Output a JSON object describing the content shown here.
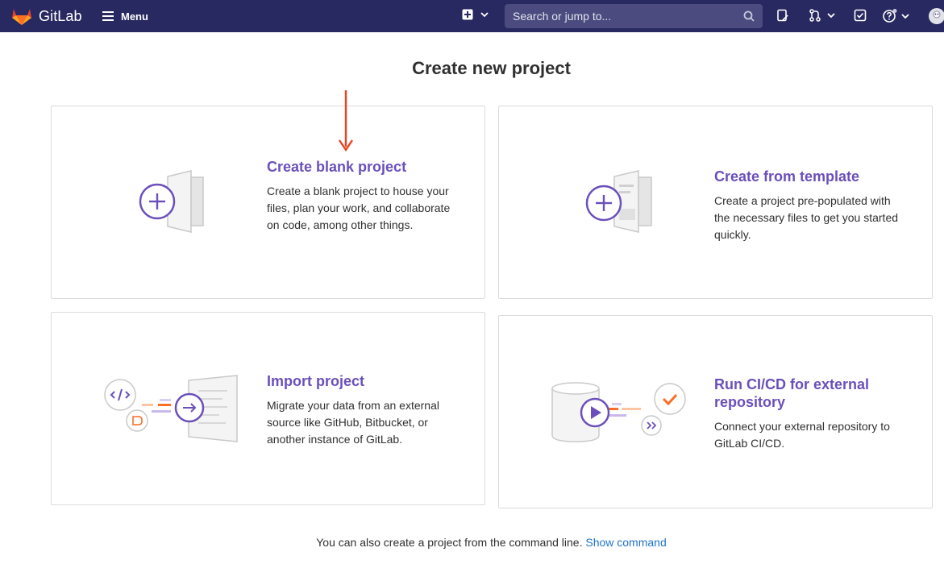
{
  "navbar": {
    "brand": "GitLab",
    "menu_label": "Menu",
    "search_placeholder": "Search or jump to..."
  },
  "page_title": "Create new project",
  "cards": {
    "blank": {
      "title": "Create blank project",
      "description": "Create a blank project to house your files, plan your work, and collaborate on code, among other things."
    },
    "template": {
      "title": "Create from template",
      "description": "Create a project pre-populated with the necessary files to get you started quickly."
    },
    "import": {
      "title": "Import project",
      "description": "Migrate your data from an external source like GitHub, Bitbucket, or another instance of GitLab."
    },
    "cicd": {
      "title": "Run CI/CD for external repository",
      "description": "Connect your external repository to GitLab CI/CD."
    }
  },
  "footer": {
    "text": "You can also create a project from the command line.",
    "link": "Show command"
  },
  "colors": {
    "navbar_bg": "#292961",
    "accent_purple": "#6b4fbb",
    "link_blue": "#1f75cb",
    "annotation_red": "#e8431f"
  }
}
